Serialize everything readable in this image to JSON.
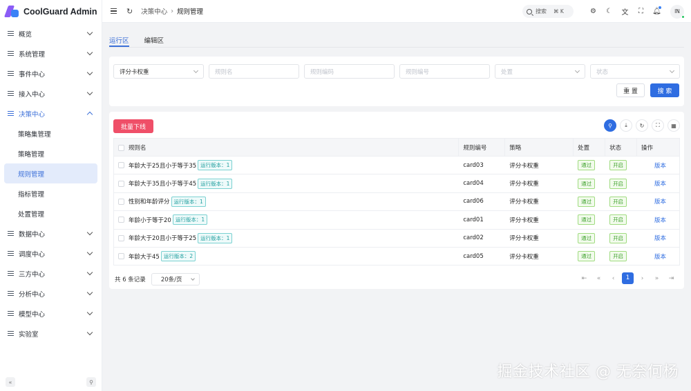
{
  "app": {
    "title": "CoolGuard Admin"
  },
  "sidebar": {
    "items": [
      {
        "label": "概览"
      },
      {
        "label": "系统管理"
      },
      {
        "label": "事件中心"
      },
      {
        "label": "接入中心"
      },
      {
        "label": "决策中心"
      },
      {
        "label": "数据中心"
      },
      {
        "label": "调度中心"
      },
      {
        "label": "三方中心"
      },
      {
        "label": "分析中心"
      },
      {
        "label": "模型中心"
      },
      {
        "label": "实验室"
      }
    ],
    "sub_items": [
      {
        "label": "策略集管理"
      },
      {
        "label": "策略管理"
      },
      {
        "label": "规则管理"
      },
      {
        "label": "指标管理"
      },
      {
        "label": "处置管理"
      }
    ],
    "footer_left": "«",
    "footer_right": "⚲"
  },
  "header": {
    "breadcrumb": [
      "决策中心",
      "规则管理"
    ],
    "search_label": "搜索",
    "search_kbd": "⌘ K",
    "avatar": "IN"
  },
  "tabs": [
    {
      "label": "运行区"
    },
    {
      "label": "编辑区"
    }
  ],
  "filters": {
    "strategy_value": "评分卡权重",
    "rule_name_placeholder": "规则名",
    "rule_code_placeholder": "规则编码",
    "rule_no_placeholder": "规则编号",
    "disposal_placeholder": "处置",
    "status_placeholder": "状态",
    "reset_label": "重 置",
    "search_label": "搜 索"
  },
  "toolbar": {
    "batch_label": "批量下线"
  },
  "table": {
    "columns": {
      "name": "规则名",
      "code": "规则编号",
      "strategy": "策略",
      "disposal": "处置",
      "status": "状态",
      "action": "操作"
    },
    "rows": [
      {
        "name": "年龄大于25且小于等于35",
        "tag": "运行版本：1",
        "code": "card03",
        "strategy": "评分卡权重",
        "disposal": "通过",
        "status": "开启",
        "action": "版本"
      },
      {
        "name": "年龄大于35且小于等于45",
        "tag": "运行版本：1",
        "code": "card04",
        "strategy": "评分卡权重",
        "disposal": "通过",
        "status": "开启",
        "action": "版本"
      },
      {
        "name": "性别和年龄评分",
        "tag": "运行版本：1",
        "code": "card06",
        "strategy": "评分卡权重",
        "disposal": "通过",
        "status": "开启",
        "action": "版本"
      },
      {
        "name": "年龄小于等于20",
        "tag": "运行版本：1",
        "code": "card01",
        "strategy": "评分卡权重",
        "disposal": "通过",
        "status": "开启",
        "action": "版本"
      },
      {
        "name": "年龄大于20且小于等于25",
        "tag": "运行版本：1",
        "code": "card02",
        "strategy": "评分卡权重",
        "disposal": "通过",
        "status": "开启",
        "action": "版本"
      },
      {
        "name": "年龄大于45",
        "tag": "运行版本：2",
        "code": "card05",
        "strategy": "评分卡权重",
        "disposal": "通过",
        "status": "开启",
        "action": "版本"
      }
    ]
  },
  "pager": {
    "total": "共 6 条记录",
    "page_size": "20条/页",
    "current_page": "1"
  },
  "watermark": "掘金技术社区 @ 无奈何杨",
  "colors": {
    "primary": "#2f6de1",
    "danger": "#ef4f68",
    "success": "#3ca02a",
    "teal": "#1f9e9e"
  }
}
